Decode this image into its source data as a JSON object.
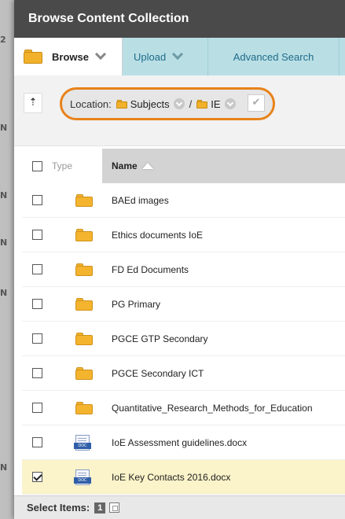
{
  "background": {
    "marks": [
      "N",
      "2",
      "N",
      "N",
      "N",
      "N"
    ]
  },
  "modal": {
    "title": "Browse Content Collection"
  },
  "tabs": [
    {
      "label": "Browse",
      "active": true
    },
    {
      "label": "Upload",
      "active": false
    },
    {
      "label": "Advanced Search",
      "active": false
    }
  ],
  "location": {
    "label": "Location:",
    "path": [
      {
        "name": "Subjects",
        "icon": "folder-icon"
      },
      {
        "name": "IE",
        "icon": "folder-icon"
      }
    ],
    "separator": "/",
    "up_icon": "up-folder-icon",
    "go_icon": "check-icon"
  },
  "table": {
    "columns": [
      "Type",
      "Name"
    ],
    "sort": {
      "column": "Name",
      "direction": "ascending"
    },
    "rows": [
      {
        "name": "BAEd images",
        "type": "folder",
        "checked": false
      },
      {
        "name": "Ethics documents IoE",
        "type": "folder",
        "checked": false
      },
      {
        "name": "FD Ed Documents",
        "type": "folder",
        "checked": false
      },
      {
        "name": "PG Primary",
        "type": "folder",
        "checked": false
      },
      {
        "name": "PGCE GTP Secondary",
        "type": "folder",
        "checked": false
      },
      {
        "name": "PGCE Secondary ICT",
        "type": "folder",
        "checked": false
      },
      {
        "name": "Quantitative_Research_Methods_for_Education",
        "type": "folder",
        "checked": false
      },
      {
        "name": "IoE Assessment guidelines.docx",
        "type": "doc",
        "checked": false
      },
      {
        "name": "IoE Key Contacts 2016.docx",
        "type": "doc",
        "checked": true
      }
    ]
  },
  "footer": {
    "label": "Select Items:",
    "count": "1"
  },
  "colors": {
    "title_bar": "#4a4a4a",
    "tab_bar": "#b9dfe5",
    "highlight_ring": "#e8821a",
    "selected_row": "#fbf3c9",
    "header_sorted": "#d3d3d3"
  }
}
